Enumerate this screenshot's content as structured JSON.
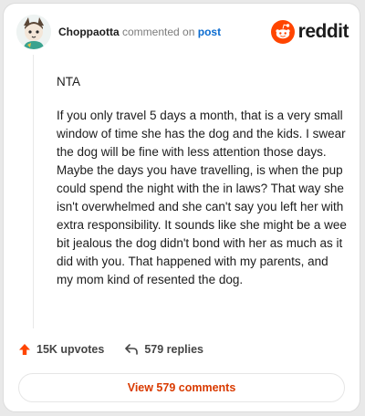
{
  "header": {
    "username": "Choppaotta",
    "action_text": "commented on",
    "post_link": "post",
    "brand": "reddit"
  },
  "comment": {
    "verdict": "NTA",
    "body": "If you only travel 5 days a month, that is a very small window of time she has the dog and the kids. I swear the dog will be fine with less attention those days. Maybe the days you have travelling, is when the pup could spend the night with the in laws? That way she isn't overwhelmed and she can't say you left her with extra responsibility. It sounds like she might be a wee bit jealous the dog didn't bond with her as much as it did with you. That happened with my parents, and my mom kind of resented the dog."
  },
  "actions": {
    "upvotes": "15K upvotes",
    "replies": "579 replies"
  },
  "view_button": "View 579 comments",
  "colors": {
    "reddit_orange": "#ff4500",
    "upvote": "#ff4500",
    "link_blue": "#0a6bd0",
    "button_text": "#d93a00"
  },
  "icons": {
    "brand": "reddit-alien-icon",
    "upvote": "upvote-arrow-icon",
    "reply": "reply-arrow-icon"
  }
}
